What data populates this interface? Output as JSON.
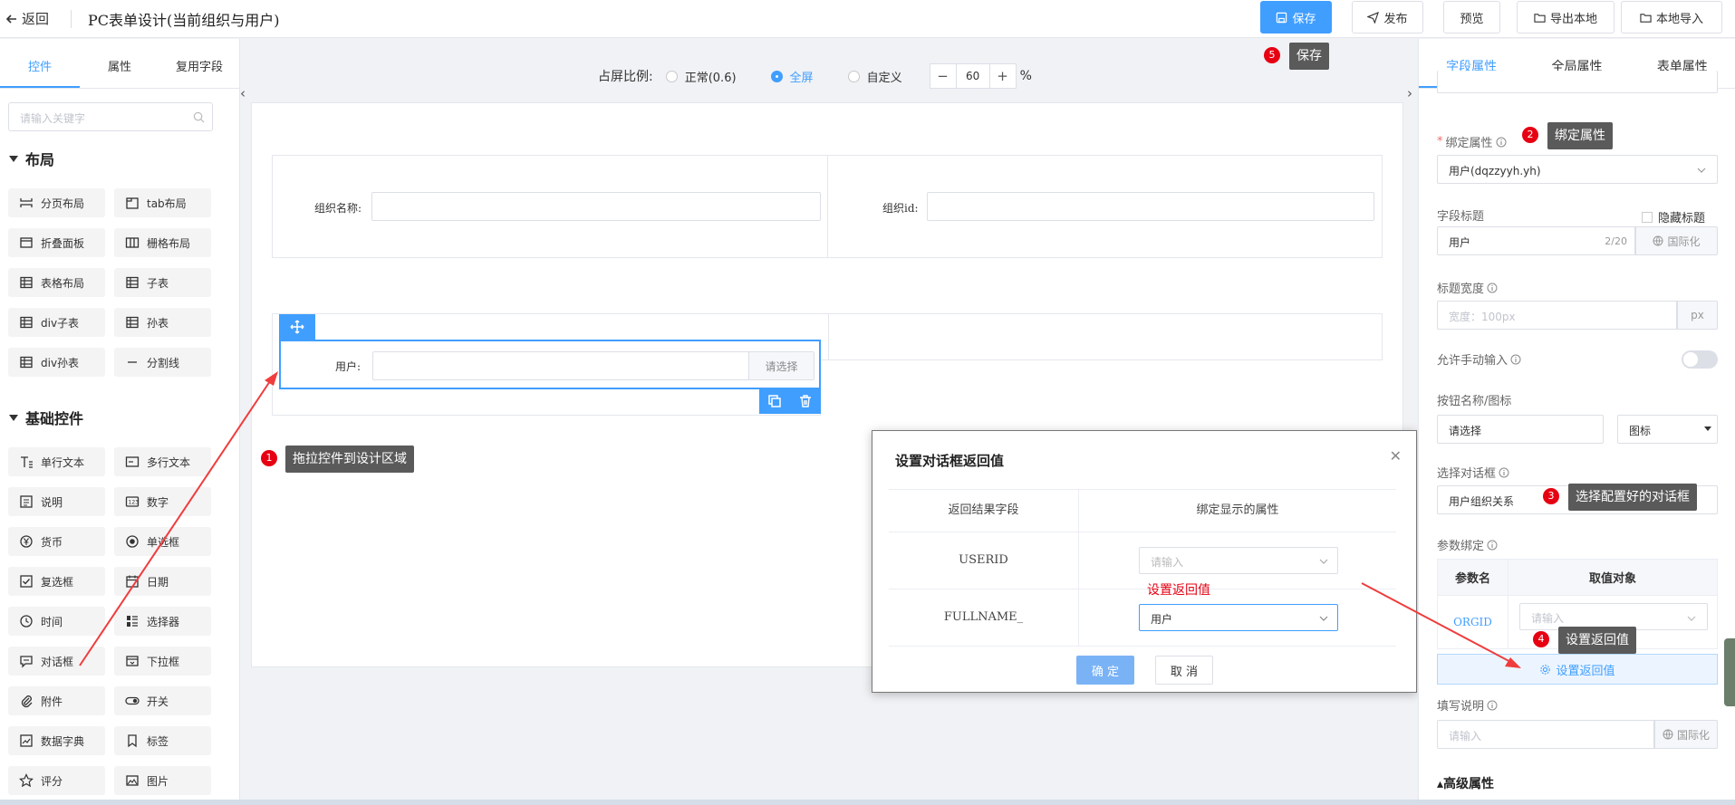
{
  "header": {
    "back_label": "返回",
    "title": "PC表单设计(当前组织与用户)",
    "save_label": "保存",
    "publish_label": "发布",
    "preview_label": "预览",
    "export_label": "导出本地",
    "import_label": "本地导入"
  },
  "left_panel": {
    "tabs": [
      "控件",
      "属性",
      "复用字段"
    ],
    "search_placeholder": "请输入关键字",
    "layout_section": "布局",
    "layout_items": [
      "分页布局",
      "tab布局",
      "折叠面板",
      "栅格布局",
      "表格布局",
      "子表",
      "div子表",
      "孙表",
      "div孙表",
      "分割线"
    ],
    "basic_section": "基础控件",
    "basic_items": [
      "单行文本",
      "多行文本",
      "说明",
      "数字",
      "货币",
      "单选框",
      "复选框",
      "日期",
      "时间",
      "选择器",
      "对话框",
      "下拉框",
      "附件",
      "开关",
      "数据字典",
      "标签",
      "评分",
      "图片"
    ]
  },
  "canvas": {
    "ratio_label": "占屏比例:",
    "option_normal": "正常(0.6)",
    "option_full": "全屏",
    "option_custom": "自定义",
    "zoom_minus": "−",
    "zoom_value": "60",
    "zoom_plus": "+",
    "zoom_unit": "%",
    "field_org_name": "组织名称:",
    "field_org_id": "组织id:",
    "field_user": "用户:",
    "user_select_button": "请选择"
  },
  "dialog": {
    "title": "设置对话框返回值",
    "col_result": "返回结果字段",
    "col_bind": "绑定显示的属性",
    "rows": [
      {
        "field": "USERID",
        "value": "请输入"
      },
      {
        "field": "FULLNAME_",
        "value": "用户"
      }
    ],
    "annotation": "设置返回值",
    "confirm": "确 定",
    "cancel": "取 消"
  },
  "right_panel": {
    "tabs": [
      "字段属性",
      "全局属性",
      "表单属性"
    ],
    "bind_required": "*",
    "bind_label": "绑定属性",
    "bind_value": "用户(dqzzyyh.yh)",
    "field_title_label": "字段标题",
    "hide_title_label": "隐藏标题",
    "field_title_value": "用户",
    "field_title_count": "2/20",
    "i18n_label": "国际化",
    "title_width_label": "标题宽度",
    "title_width_placeholder": "宽度：100px",
    "title_width_unit": "px",
    "allow_input_label": "允许手动输入",
    "button_name_label": "按钮名称/图标",
    "button_name_value": "请选择",
    "icon_label": "图标",
    "select_dialog_label": "选择对话框",
    "select_dialog_value": "用户组织关系",
    "param_bind_label": "参数绑定",
    "param_col_name": "参数名",
    "param_col_value": "取值对象",
    "param_name": "ORGID",
    "param_placeholder": "请输入",
    "set_return_label": "设置返回值",
    "fill_desc_label": "填写说明",
    "fill_desc_placeholder": "请输入",
    "fill_i18n_label": "国际化",
    "advanced_label": "高级属性"
  },
  "annotations": [
    {
      "num": "1",
      "text": "拖拉控件到设计区域"
    },
    {
      "num": "2",
      "text": "绑定属性"
    },
    {
      "num": "3",
      "text": "选择配置好的对话框"
    },
    {
      "num": "4",
      "text": "设置返回值"
    },
    {
      "num": "5",
      "text": "保存"
    }
  ],
  "colors": {
    "primary": "#409eff",
    "annotation_red": "#e60012",
    "tooltip_bg": "#5a5a5a"
  }
}
